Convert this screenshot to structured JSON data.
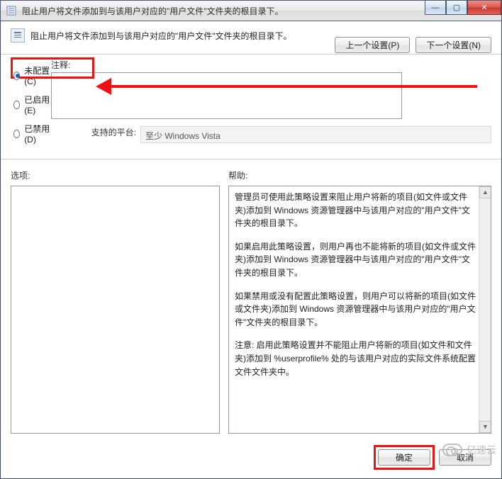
{
  "window": {
    "title": "阻止用户将文件添加到与该用户对应的\"用户文件\"文件夹的根目录下。",
    "min": "—",
    "max": "▢",
    "close": "✕"
  },
  "header": {
    "title": "阻止用户将文件添加到与该用户对应的\"用户文件\"文件夹的根目录下。",
    "prev": "上一个设置(P)",
    "next": "下一个设置(N)"
  },
  "options": {
    "not_configured": "未配置(C)",
    "enabled": "已启用(E)",
    "disabled": "已禁用(D)",
    "selected": "not_configured"
  },
  "comment": {
    "label": "注释:",
    "value": ""
  },
  "platform": {
    "label": "支持的平台:",
    "value": "至少 Windows Vista"
  },
  "columns": {
    "options_label": "选项:",
    "help_label": "帮助:"
  },
  "help": {
    "p1": "管理员可使用此策略设置来阻止用户将新的项目(如文件或文件夹)添加到 Windows 资源管理器中与该用户对应的\"用户文件\"文件夹的根目录下。",
    "p2": "如果启用此策略设置，则用户再也不能将新的项目(如文件或文件夹)添加到 Windows 资源管理器中与该用户对应的\"用户文件\"文件夹的根目录下。",
    "p3": "如果禁用或没有配置此策略设置，则用户可以将新的项目(如文件或文件夹)添加到 Windows 资源管理器中与该用户对应的\"用户文件\"文件夹的根目录下。",
    "p4": "注意: 启用此策略设置并不能阻止用户将新的项目(如文件和文件夹)添加到 %userprofile% 处的与该用户对应的实际文件系统配置文件文件夹中。"
  },
  "footer": {
    "ok": "确定",
    "cancel": "取消"
  },
  "watermark": "亿速云"
}
